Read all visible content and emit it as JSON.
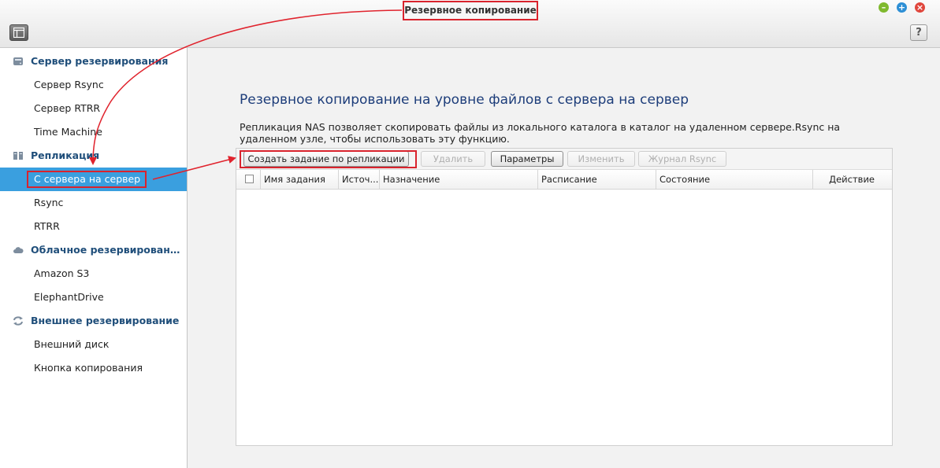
{
  "window": {
    "title": "Резервное копирование",
    "help_label": "?",
    "controls": {
      "minimize": "–",
      "maximize": "+",
      "close": "×"
    }
  },
  "sidebar": {
    "sections": [
      {
        "label": "Сервер резервирования",
        "icon": "server-icon",
        "items": [
          {
            "label": "Сервер Rsync"
          },
          {
            "label": "Сервер RTRR"
          },
          {
            "label": "Time Machine"
          }
        ]
      },
      {
        "label": "Репликация",
        "icon": "replication-icon",
        "items": [
          {
            "label": "С сервера на сервер",
            "active": true
          },
          {
            "label": "Rsync"
          },
          {
            "label": "RTRR"
          }
        ]
      },
      {
        "label": "Облачное резервирование",
        "icon": "cloud-icon",
        "items": [
          {
            "label": "Amazon S3"
          },
          {
            "label": "ElephantDrive"
          }
        ]
      },
      {
        "label": "Внешнее резервирование",
        "icon": "sync-icon",
        "items": [
          {
            "label": "Внешний диск"
          },
          {
            "label": "Кнопка копирования"
          }
        ]
      }
    ]
  },
  "main": {
    "title": "Резервное копирование на уровне файлов с сервера на сервер",
    "description": "Репликация NAS позволяет скопировать файлы из локального каталога в каталог на удаленном сервере.Rsync на удаленном узле, чтобы использовать эту функцию.",
    "toolbar": {
      "create": "Создать задание по репликации",
      "delete": "Удалить",
      "params": "Параметры",
      "edit": "Изменить",
      "log": "Журнал Rsync"
    },
    "table": {
      "columns": [
        "Имя задания",
        "Источ...",
        "Назначение",
        "Расписание",
        "Состояние",
        "Действие"
      ],
      "rows": []
    }
  },
  "colors": {
    "accent": "#3a9fdf",
    "highlight": "#d9232d",
    "heading": "#1d3d7a"
  }
}
